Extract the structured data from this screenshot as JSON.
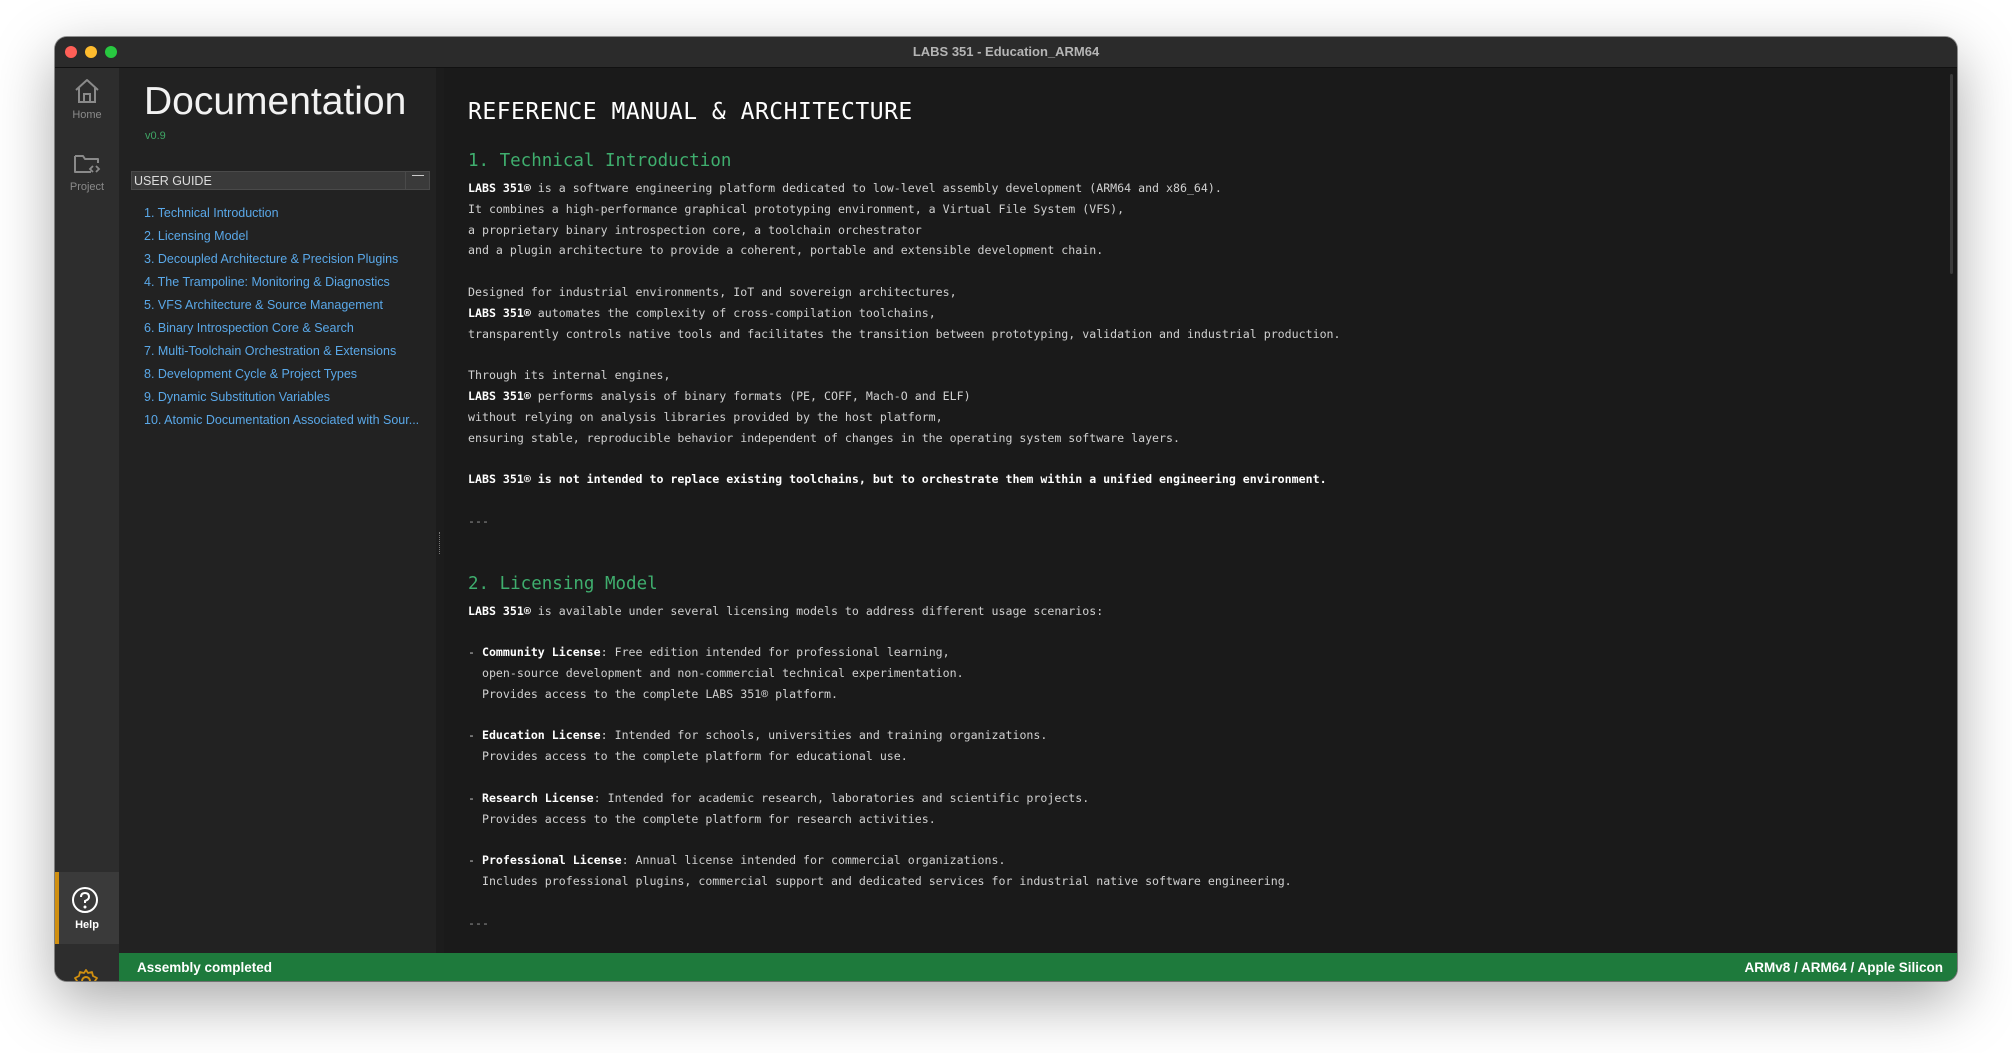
{
  "window": {
    "title": "LABS 351 - Education_ARM64"
  },
  "activity_bar": {
    "home_label": "Home",
    "project_label": "Project",
    "help_label": "Help"
  },
  "sidebar": {
    "title": "Documentation",
    "version": "v0.9",
    "section_label": "USER GUIDE",
    "items": [
      "1. Technical Introduction",
      "2. Licensing Model",
      "3. Decoupled Architecture & Precision Plugins",
      "4. The Trampoline: Monitoring & Diagnostics",
      "5. VFS Architecture & Source Management",
      "6. Binary Introspection Core & Search",
      "7. Multi-Toolchain Orchestration & Extensions",
      "8. Development Cycle & Project Types",
      "9. Dynamic Substitution Variables",
      "10. Atomic Documentation Associated with Sour..."
    ]
  },
  "content": {
    "heading": "REFERENCE MANUAL & ARCHITECTURE",
    "s1_title": "1. Technical Introduction",
    "brand": "LABS 351®",
    "s1_p1_l1": " is a software engineering platform dedicated to low-level assembly development (ARM64 and x86_64).",
    "s1_p1_l2": "It combines a high-performance graphical prototyping environment, a Virtual File System (VFS),",
    "s1_p1_l3": "a proprietary binary introspection core, a toolchain orchestrator",
    "s1_p1_l4": "and a plugin architecture to provide a coherent, portable and extensible development chain.",
    "s1_p2_l1": "Designed for industrial environments, IoT and sovereign architectures,",
    "s1_p2_l2": " automates the complexity of cross-compilation toolchains,",
    "s1_p2_l3": "transparently controls native tools and facilitates the transition between prototyping, validation and industrial production.",
    "s1_p3_l1": "Through its internal engines,",
    "s1_p3_l2": " performs analysis of binary formats (PE, COFF, Mach-O and ELF)",
    "s1_p3_l3": "without relying on analysis libraries provided by the host platform,",
    "s1_p3_l4": "ensuring stable, reproducible behavior independent of changes in the operating system software layers.",
    "s1_p4": "LABS 351® is not intended to replace existing toolchains, but to orchestrate them within a unified engineering environment.",
    "separator": "---",
    "s2_title": "2. Licensing Model",
    "s2_intro": " is available under several licensing models to address different usage scenarios:",
    "bullet": "- ",
    "indent": "  ",
    "lic1_name": "Community License",
    "lic1_l1": ": Free edition intended for professional learning,",
    "lic1_l2": "open-source development and non-commercial technical experimentation.",
    "lic1_l3": "Provides access to the complete LABS 351® platform.",
    "lic2_name": "Education License",
    "lic2_l1": ": Intended for schools, universities and training organizations.",
    "lic2_l2": "Provides access to the complete platform for educational use.",
    "lic3_name": "Research License",
    "lic3_l1": ": Intended for academic research, laboratories and scientific projects.",
    "lic3_l2": "Provides access to the complete platform for research activities.",
    "lic4_name": "Professional License",
    "lic4_l1": ": Annual license intended for commercial organizations.",
    "lic4_l2": "Includes professional plugins, commercial support and dedicated services for industrial native software engineering."
  },
  "statusbar": {
    "left": "Assembly completed",
    "right": "ARMv8 / ARM64 / Apple Silicon"
  },
  "colors": {
    "accent_green": "#3fae6e",
    "status_green": "#1e7a3c",
    "link_blue": "#5aa8e8",
    "help_accent": "#d08f10"
  },
  "icons": [
    "home-icon",
    "folder-code-icon",
    "help-icon",
    "settings-gear-icon"
  ]
}
